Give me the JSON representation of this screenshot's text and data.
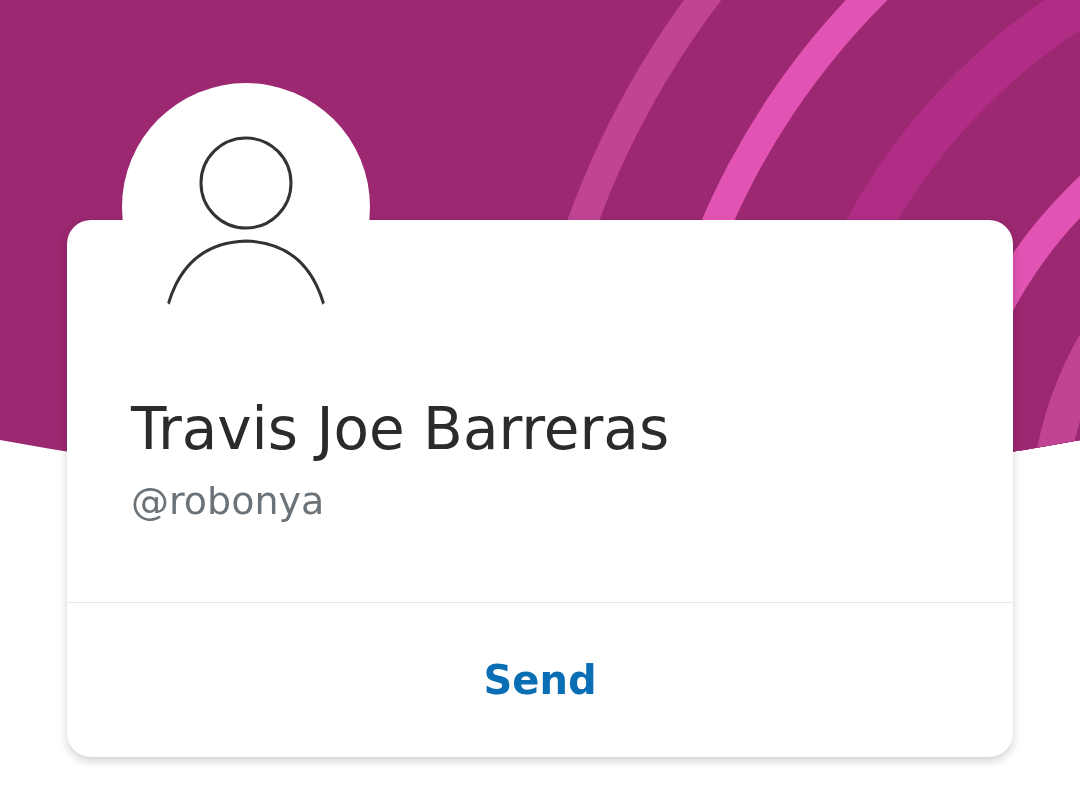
{
  "profile": {
    "name": "Travis Joe Barreras",
    "handle": "@robonya"
  },
  "actions": [
    {
      "label": "Send"
    }
  ]
}
